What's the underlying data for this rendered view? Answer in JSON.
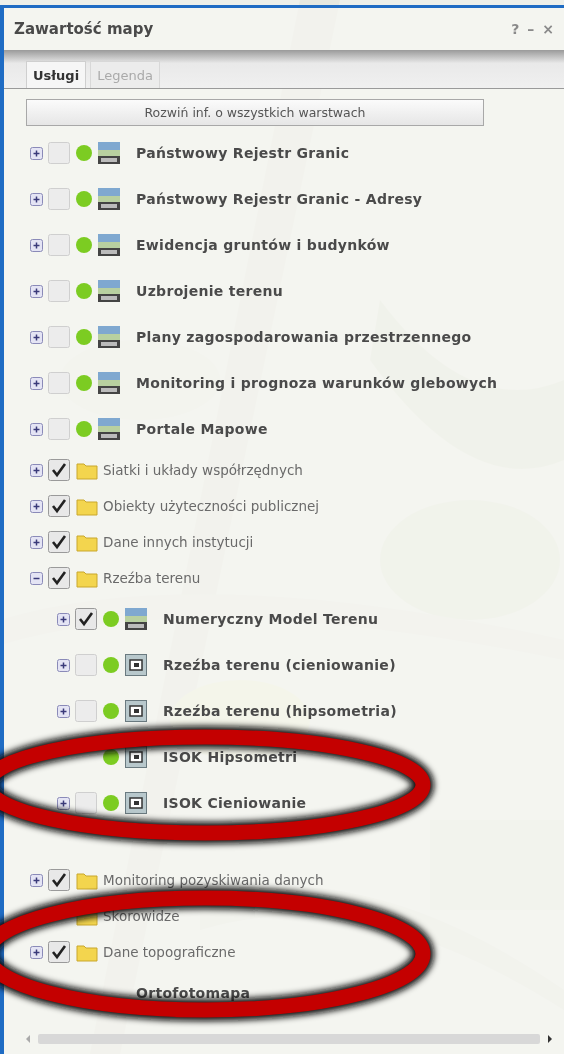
{
  "window": {
    "title": "Zawartość mapy",
    "header_buttons": [
      "?",
      "–",
      "×"
    ]
  },
  "tabs": [
    {
      "label": "Usługi",
      "selected": true
    },
    {
      "label": "Legenda",
      "selected": false
    }
  ],
  "expand_all_button": "Rozwiń inf. o wszystkich warstwach",
  "layers": [
    {
      "kind": "wms",
      "name": "Państwowy Rejestr Granic",
      "checked": false,
      "expanded": false
    },
    {
      "kind": "wms",
      "name": "Państwowy Rejestr Granic - Adresy",
      "checked": false,
      "expanded": false
    },
    {
      "kind": "wms",
      "name": "Ewidencja gruntów i budynków",
      "checked": false,
      "expanded": false
    },
    {
      "kind": "wms",
      "name": "Uzbrojenie terenu",
      "checked": false,
      "expanded": false
    },
    {
      "kind": "wms",
      "name": "Plany zagospodarowania przestrzennego",
      "checked": false,
      "expanded": false
    },
    {
      "kind": "wms",
      "name": "Monitoring i prognoza warunków glebowych",
      "checked": false,
      "expanded": false
    },
    {
      "kind": "wms",
      "name": "Portale Mapowe",
      "checked": false,
      "expanded": false
    },
    {
      "kind": "folder",
      "name": "Siatki i układy współrzędnych",
      "checked": true,
      "expanded": false
    },
    {
      "kind": "folder",
      "name": "Obiekty użyteczności publicznej",
      "checked": true,
      "expanded": false
    },
    {
      "kind": "folder",
      "name": "Dane innych instytucji",
      "checked": true,
      "expanded": false
    },
    {
      "kind": "folder",
      "name": "Rzeźba terenu",
      "checked": true,
      "expanded": true,
      "children": [
        {
          "kind": "wms",
          "name": "Numeryczny Model Terenu",
          "checked": true,
          "expanded": false
        },
        {
          "kind": "tile",
          "name": "Rzeźba terenu (cieniowanie)",
          "checked": false,
          "expanded": false
        },
        {
          "kind": "tile",
          "name": "Rzeźba terenu (hipsometria)",
          "checked": false,
          "expanded": false
        },
        {
          "kind": "tile",
          "name": "ISOK Hipsometri"
        },
        {
          "kind": "tile",
          "name": "ISOK Cieniowanie",
          "checked": false,
          "expanded": false
        }
      ]
    },
    {
      "kind": "folder",
      "name": "Monitoring pozyskiwania danych",
      "checked": true,
      "expanded": false
    },
    {
      "kind": "folder",
      "name": "Skorowidze"
    },
    {
      "kind": "folder",
      "name": "Dane topograficzne",
      "checked": true,
      "expanded": false
    },
    {
      "kind": "covered",
      "name": "Ortofotomapa"
    }
  ]
}
